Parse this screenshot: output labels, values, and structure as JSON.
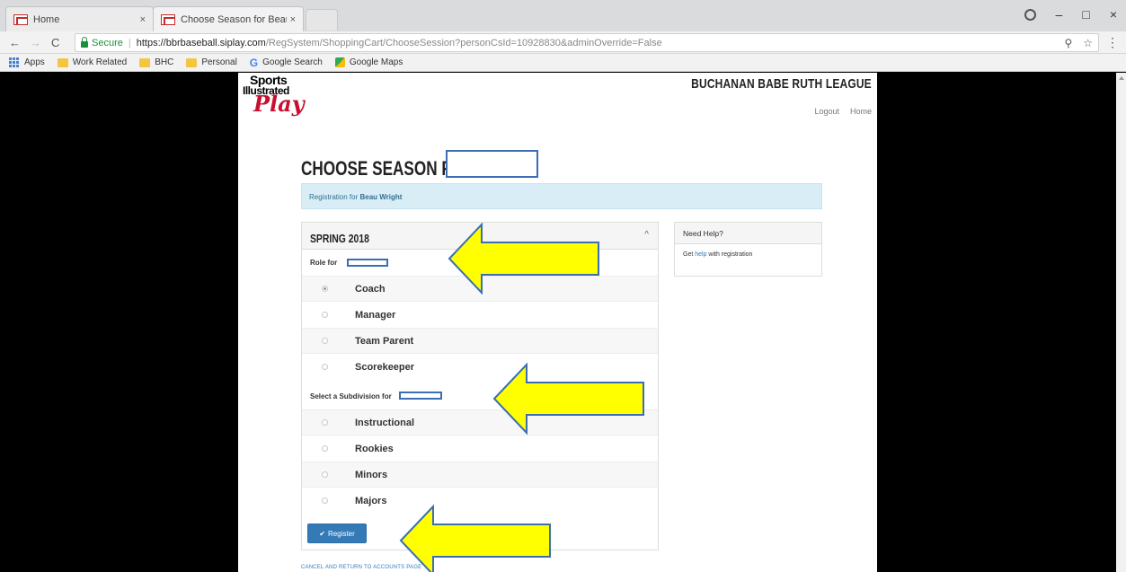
{
  "browser": {
    "tabs": [
      {
        "label": "Home",
        "close": "×"
      },
      {
        "label": "Choose Season for Beau",
        "close": "×"
      }
    ],
    "window_controls": {
      "minimize": "–",
      "restore": "□",
      "close": "×"
    },
    "address": {
      "secure_label": "Secure",
      "separator": "|",
      "url_host": "https://bbrbaseball.siplay.com",
      "url_path": "/RegSystem/ShoppingCart/ChooseSession?personCsId=10928830&adminOverride=False"
    },
    "bookmarks": [
      "Apps",
      "Work Related",
      "BHC",
      "Personal",
      "Google Search",
      "Google Maps"
    ]
  },
  "site": {
    "logo": {
      "line1": "Sports",
      "line2": "Illustrated",
      "line3": "Play"
    },
    "league_name": "BUCHANAN BABE RUTH LEAGUE",
    "top_links": [
      "Logout",
      "Home"
    ]
  },
  "page": {
    "title": "CHOOSE SEASON FOR",
    "info_prefix": "Registration for ",
    "info_name": "Beau Wright"
  },
  "season_panel": {
    "title": "SPRING 2018",
    "collapse_glyph": "^",
    "role_label": "Role for",
    "roles": [
      {
        "label": "Coach",
        "checked": true
      },
      {
        "label": "Manager",
        "checked": false
      },
      {
        "label": "Team Parent",
        "checked": false
      },
      {
        "label": "Scorekeeper",
        "checked": false
      }
    ],
    "subdivision_label": "Select a Subdivision for",
    "subdivisions": [
      {
        "label": "Instructional",
        "checked": false
      },
      {
        "label": "Rookies",
        "checked": false
      },
      {
        "label": "Minors",
        "checked": false
      },
      {
        "label": "Majors",
        "checked": false
      }
    ],
    "register_label": "Register",
    "register_glyph": "✔"
  },
  "cancel_link": "CANCEL AND RETURN TO ACCOUNTS PAGE",
  "help_panel": {
    "title": "Need Help?",
    "body_prefix": "Get ",
    "body_link": "help",
    "body_suffix": " with registration"
  },
  "colors": {
    "primary": "#337ab7",
    "info_bg": "#d9edf7",
    "annotation_fill": "#ffff00",
    "annotation_stroke": "#3c6eb4",
    "brand_red": "#c8102e"
  }
}
